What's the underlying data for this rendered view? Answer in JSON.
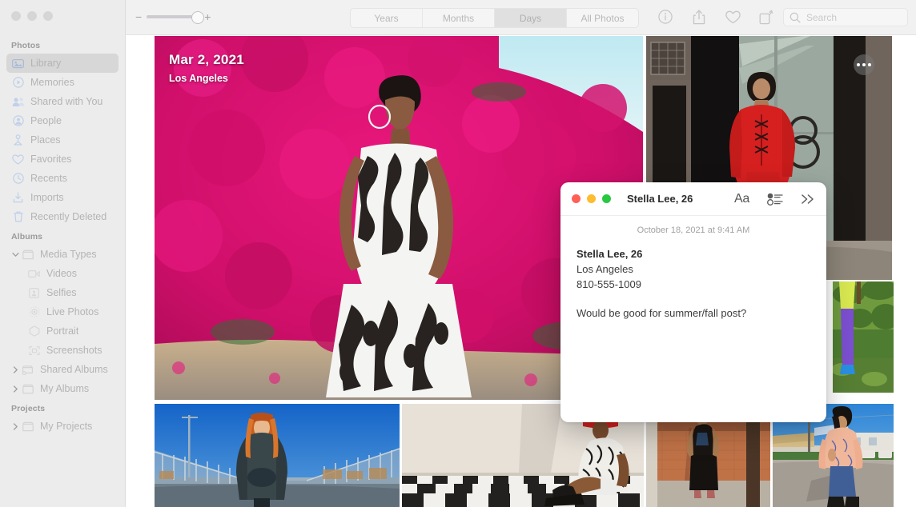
{
  "window": {
    "traffic_lights": [
      "close",
      "minimize",
      "zoom"
    ]
  },
  "sidebar": {
    "sections": [
      {
        "title": "Photos",
        "items": [
          {
            "label": "Library",
            "icon": "library-icon",
            "selected": true
          },
          {
            "label": "Memories",
            "icon": "memories-icon",
            "selected": false
          },
          {
            "label": "Shared with You",
            "icon": "shared-with-you-icon",
            "selected": false
          },
          {
            "label": "People",
            "icon": "people-icon",
            "selected": false
          },
          {
            "label": "Places",
            "icon": "places-pin-icon",
            "selected": false
          },
          {
            "label": "Favorites",
            "icon": "heart-icon",
            "selected": false
          },
          {
            "label": "Recents",
            "icon": "clock-icon",
            "selected": false
          },
          {
            "label": "Imports",
            "icon": "import-arrow-icon",
            "selected": false
          },
          {
            "label": "Recently Deleted",
            "icon": "trash-icon",
            "selected": false
          }
        ]
      },
      {
        "title": "Albums",
        "items": [
          {
            "label": "Media Types",
            "icon": "folder-icon",
            "disclosure": "expanded",
            "selected": false
          },
          {
            "label": "Videos",
            "icon": "video-icon",
            "indent": 1,
            "selected": false
          },
          {
            "label": "Selfies",
            "icon": "selfie-icon",
            "indent": 1,
            "selected": false
          },
          {
            "label": "Live Photos",
            "icon": "live-photo-icon",
            "indent": 1,
            "selected": false
          },
          {
            "label": "Portrait",
            "icon": "portrait-icon",
            "indent": 1,
            "selected": false
          },
          {
            "label": "Screenshots",
            "icon": "screenshot-icon",
            "indent": 1,
            "selected": false
          },
          {
            "label": "Shared Albums",
            "icon": "shared-folder-icon",
            "disclosure": "collapsed",
            "selected": false
          },
          {
            "label": "My Albums",
            "icon": "folder-icon",
            "disclosure": "collapsed",
            "selected": false
          }
        ]
      },
      {
        "title": "Projects",
        "items": [
          {
            "label": "My Projects",
            "icon": "folder-icon",
            "disclosure": "collapsed",
            "selected": false
          }
        ]
      }
    ]
  },
  "toolbar": {
    "zoom_slider": {
      "minus": "−",
      "plus": "+",
      "value": 100
    },
    "view_modes": [
      {
        "label": "Years",
        "selected": false
      },
      {
        "label": "Months",
        "selected": false
      },
      {
        "label": "Days",
        "selected": true
      },
      {
        "label": "All Photos",
        "selected": false
      }
    ],
    "icons": [
      {
        "name": "info-icon"
      },
      {
        "name": "share-icon"
      },
      {
        "name": "heart-icon"
      },
      {
        "name": "rotate-icon"
      }
    ],
    "search": {
      "placeholder": "Search",
      "value": "",
      "icon": "search-icon"
    }
  },
  "content": {
    "day_header": {
      "date": "Mar 2, 2021",
      "location": "Los Angeles"
    },
    "more_button": {
      "name": "more-options-button",
      "glyph": "•••"
    }
  },
  "note_window": {
    "traffic_lights": {
      "close": "#ff5f57",
      "minimize": "#febc2e",
      "zoom": "#28c840"
    },
    "title": "Stella Lee, 26",
    "tools": [
      {
        "name": "format-aa-button",
        "label": "Aa"
      },
      {
        "name": "checklist-button",
        "label": ""
      },
      {
        "name": "expand-chevrons-button",
        "label": "»"
      }
    ],
    "date": "October 18, 2021 at 9:41 AM",
    "lines": [
      {
        "text": "Stella Lee, 26",
        "bold": true
      },
      {
        "text": "Los Angeles",
        "bold": false
      },
      {
        "text": "810-555-1009",
        "bold": false
      },
      {
        "text": "",
        "bold": false
      },
      {
        "text": "Would be good for summer/fall post?",
        "bold": false
      }
    ]
  },
  "colors": {
    "sidebar_bg": "#ececec",
    "toolbar_bg": "#f1f1f1",
    "selected_row": "#d7d7d7",
    "accent_blue": "#bfd0e8",
    "note_bg": "#ffffff"
  }
}
